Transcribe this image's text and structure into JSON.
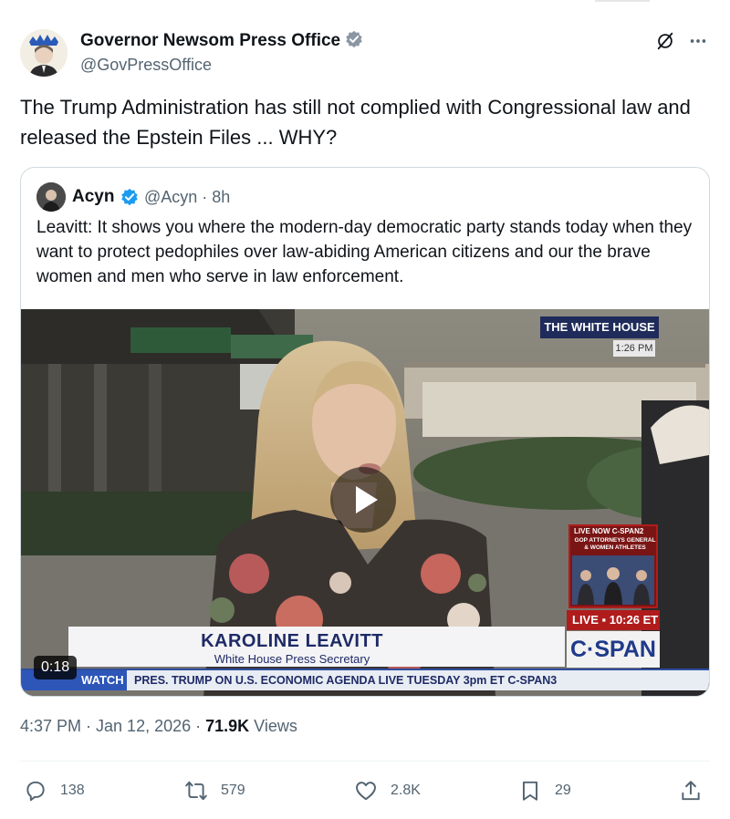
{
  "author": {
    "name": "Governor Newsom Press Office",
    "handle": "@GovPressOffice",
    "verified": true,
    "badge_color": "#1d9bf0"
  },
  "tweet": {
    "text": "The Trump Administration has still not complied with Congressional law and released the Epstein Files ... WHY?"
  },
  "quoted": {
    "name": "Acyn",
    "handle": "@Acyn · 8h",
    "text": "Leavitt: It shows you where the modern-day democratic party stands today when they want to protect pedophiles over law-abiding American citizens and our the brave women and men who serve in law enforcement.",
    "video": {
      "duration": "0:18",
      "overlay": {
        "location_title": "THE WHITE HOUSE",
        "location_time": "1:26 PM",
        "lower_third_name": "KAROLINE LEAVITT",
        "lower_third_title": "White House Press Secretary",
        "ticker_tag": "WATCH",
        "ticker_text": "PRES. TRUMP ON U.S. ECONOMIC AGENDA LIVE TUESDAY 3pm ET C-SPAN3",
        "pip_header": "LIVE NOW C-SPAN2",
        "pip_caption": "GOP ATTORNEYS GENERAL & WOMEN ATHLETES",
        "live_label": "LIVE ▪ 10:26 ET",
        "network": "C·SPAN"
      }
    }
  },
  "meta": {
    "time_date": "4:37 PM · Jan 12, 2026 · ",
    "views_count": "71.9K",
    "views_label": " Views"
  },
  "actions": {
    "replies": "138",
    "reposts": "579",
    "likes": "2.8K",
    "bookmarks": "29"
  },
  "icons": [
    "verified-badge-icon",
    "grok-icon",
    "more-icon",
    "play-icon",
    "reply-icon",
    "repost-icon",
    "like-icon",
    "bookmark-icon",
    "share-icon"
  ]
}
